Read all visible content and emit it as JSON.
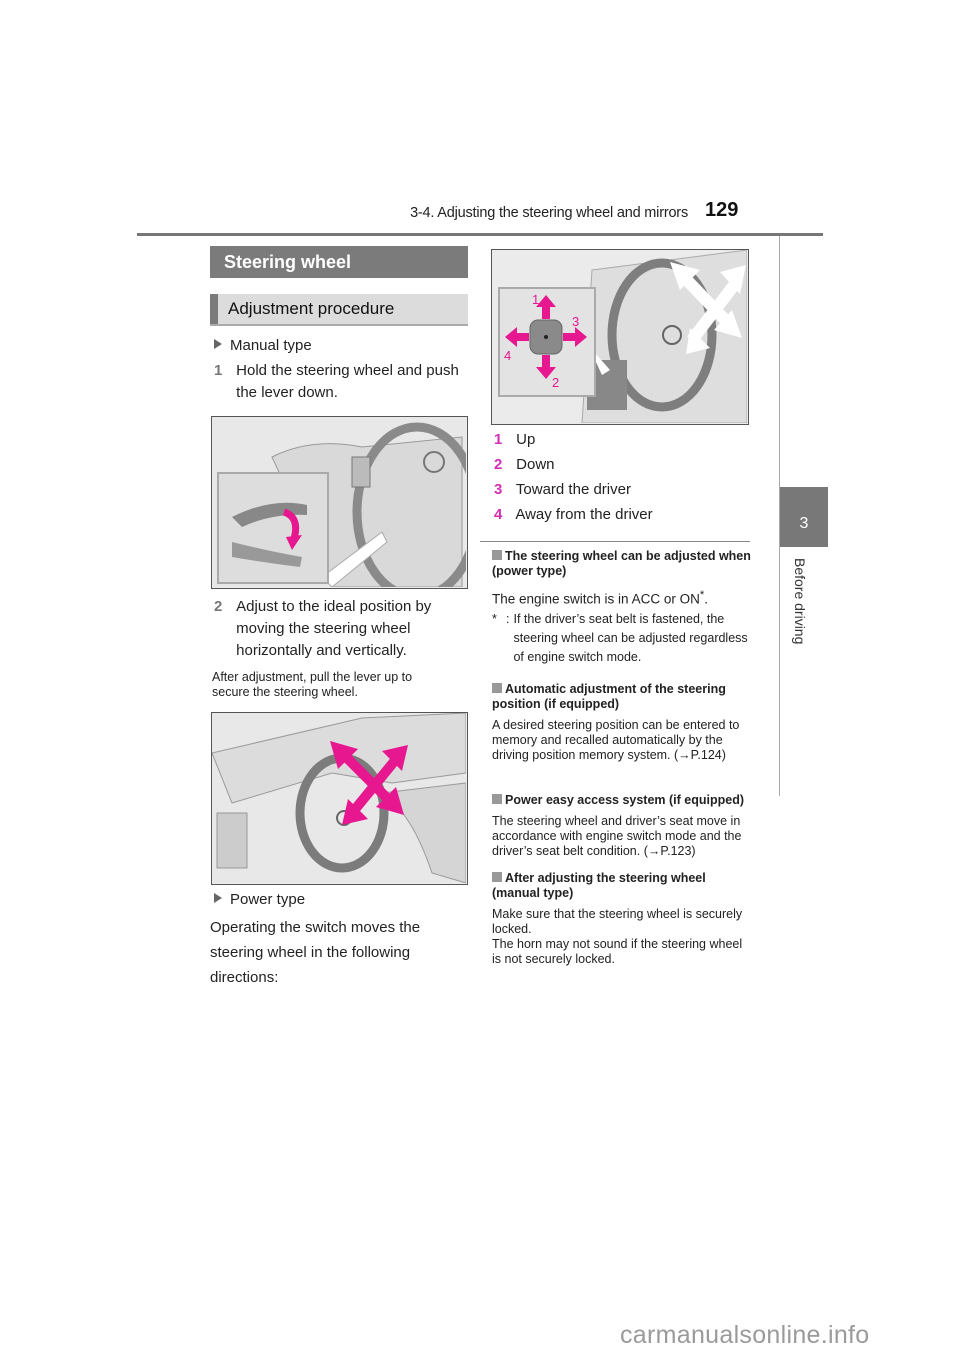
{
  "header": {
    "section_title": "3-4. Adjusting the steering wheel and mirrors",
    "page_number": "129"
  },
  "side_tab": {
    "chapter_number": "3",
    "chapter_label": "Before driving"
  },
  "headings": {
    "main": "Steering wheel",
    "sub": "Adjustment procedure"
  },
  "left_column": {
    "manual_type_label": "Manual type",
    "step1": {
      "num": "1",
      "text": "Hold the steering wheel and push the lever down."
    },
    "step2": {
      "num": "2",
      "text": "Adjust to the ideal position by moving the steering wheel horizontally and vertically."
    },
    "after_note": "After adjustment, pull the lever up to secure the steering wheel.",
    "power_type_label": "Power type",
    "power_intro": "Operating the switch moves the steering wheel in the following directions:"
  },
  "figure_labels": {
    "up": "1",
    "down": "2",
    "toward": "3",
    "away": "4"
  },
  "directions": [
    {
      "num": "1",
      "text": "Up"
    },
    {
      "num": "2",
      "text": "Down"
    },
    {
      "num": "3",
      "text": "Toward the driver"
    },
    {
      "num": "4",
      "text": "Away from the driver"
    }
  ],
  "notes": [
    {
      "title": "The steering wheel can be adjusted when (power type)",
      "body": "The engine switch is in ACC or ON",
      "footnote_mark": "*",
      "footnote": "If the driver’s seat belt is fastened, the steering wheel can be adjusted regardless of engine switch mode."
    },
    {
      "title": "Automatic adjustment of the steering position (if equipped)",
      "body": "A desired steering position can be entered to memory and recalled automatically by the driving position memory system. (→P.124)"
    },
    {
      "title": "Power easy access system (if equipped)",
      "body": "The steering wheel and driver’s seat move in accordance with engine switch mode and the driver’s seat belt condition. (→P.123)"
    },
    {
      "title": "After adjusting the steering wheel (manual type)",
      "body": "Make sure that the steering wheel is securely locked.",
      "body2": "The horn may not sound if the steering wheel is not securely locked."
    }
  ],
  "colors": {
    "accent_pink": "#e6178f",
    "heading_gray": "#7b7b7b",
    "number_pink": "#d42fb4"
  },
  "watermark": "carmanualsonline.info"
}
